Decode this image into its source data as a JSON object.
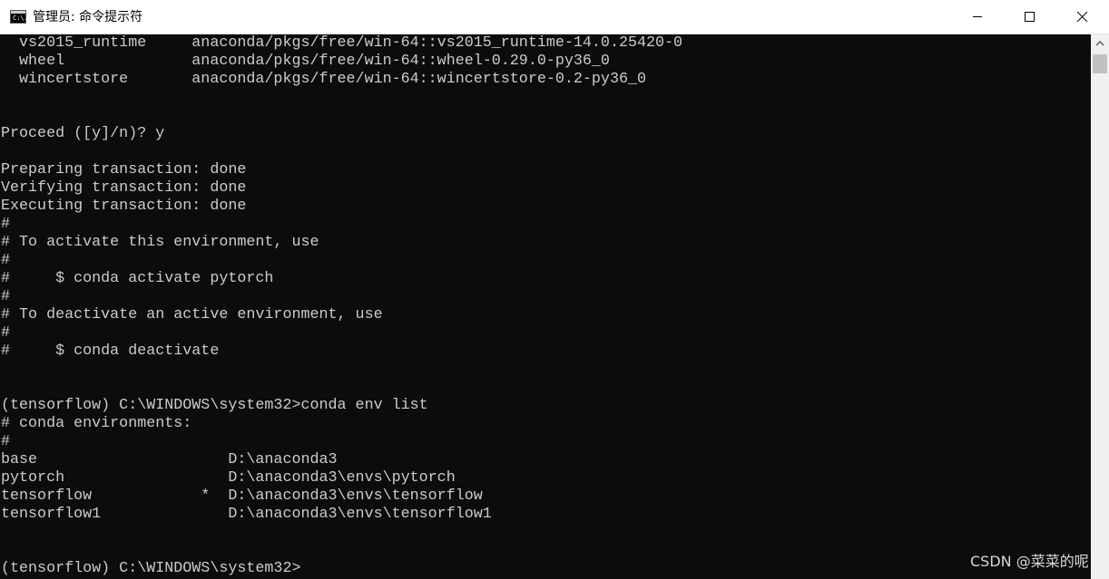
{
  "window": {
    "title": "管理员: 命令提示符",
    "icon": "cmd-icon",
    "icon_text": "C:\\."
  },
  "controls": {
    "minimize_icon": "minimize-icon",
    "maximize_icon": "maximize-icon",
    "close_icon": "close-icon"
  },
  "console": {
    "lines": [
      "  vs2015_runtime     anaconda/pkgs/free/win-64::vs2015_runtime-14.0.25420-0",
      "  wheel              anaconda/pkgs/free/win-64::wheel-0.29.0-py36_0",
      "  wincertstore       anaconda/pkgs/free/win-64::wincertstore-0.2-py36_0",
      "",
      "",
      "Proceed ([y]/n)? y",
      "",
      "Preparing transaction: done",
      "Verifying transaction: done",
      "Executing transaction: done",
      "#",
      "# To activate this environment, use",
      "#",
      "#     $ conda activate pytorch",
      "#",
      "# To deactivate an active environment, use",
      "#",
      "#     $ conda deactivate",
      "",
      "",
      "(tensorflow) C:\\WINDOWS\\system32>conda env list",
      "# conda environments:",
      "#",
      "base                     D:\\anaconda3",
      "pytorch                  D:\\anaconda3\\envs\\pytorch",
      "tensorflow            *  D:\\anaconda3\\envs\\tensorflow",
      "tensorflow1              D:\\anaconda3\\envs\\tensorflow1",
      "",
      "",
      "(tensorflow) C:\\WINDOWS\\system32>"
    ]
  },
  "scrollbar": {
    "up_icon": "scroll-up-arrow-icon"
  },
  "watermark": "CSDN @菜菜的呢",
  "colors": {
    "console_bg": "#0c0c0c",
    "console_text": "#cccccc",
    "titlebar_bg": "#ffffff"
  }
}
